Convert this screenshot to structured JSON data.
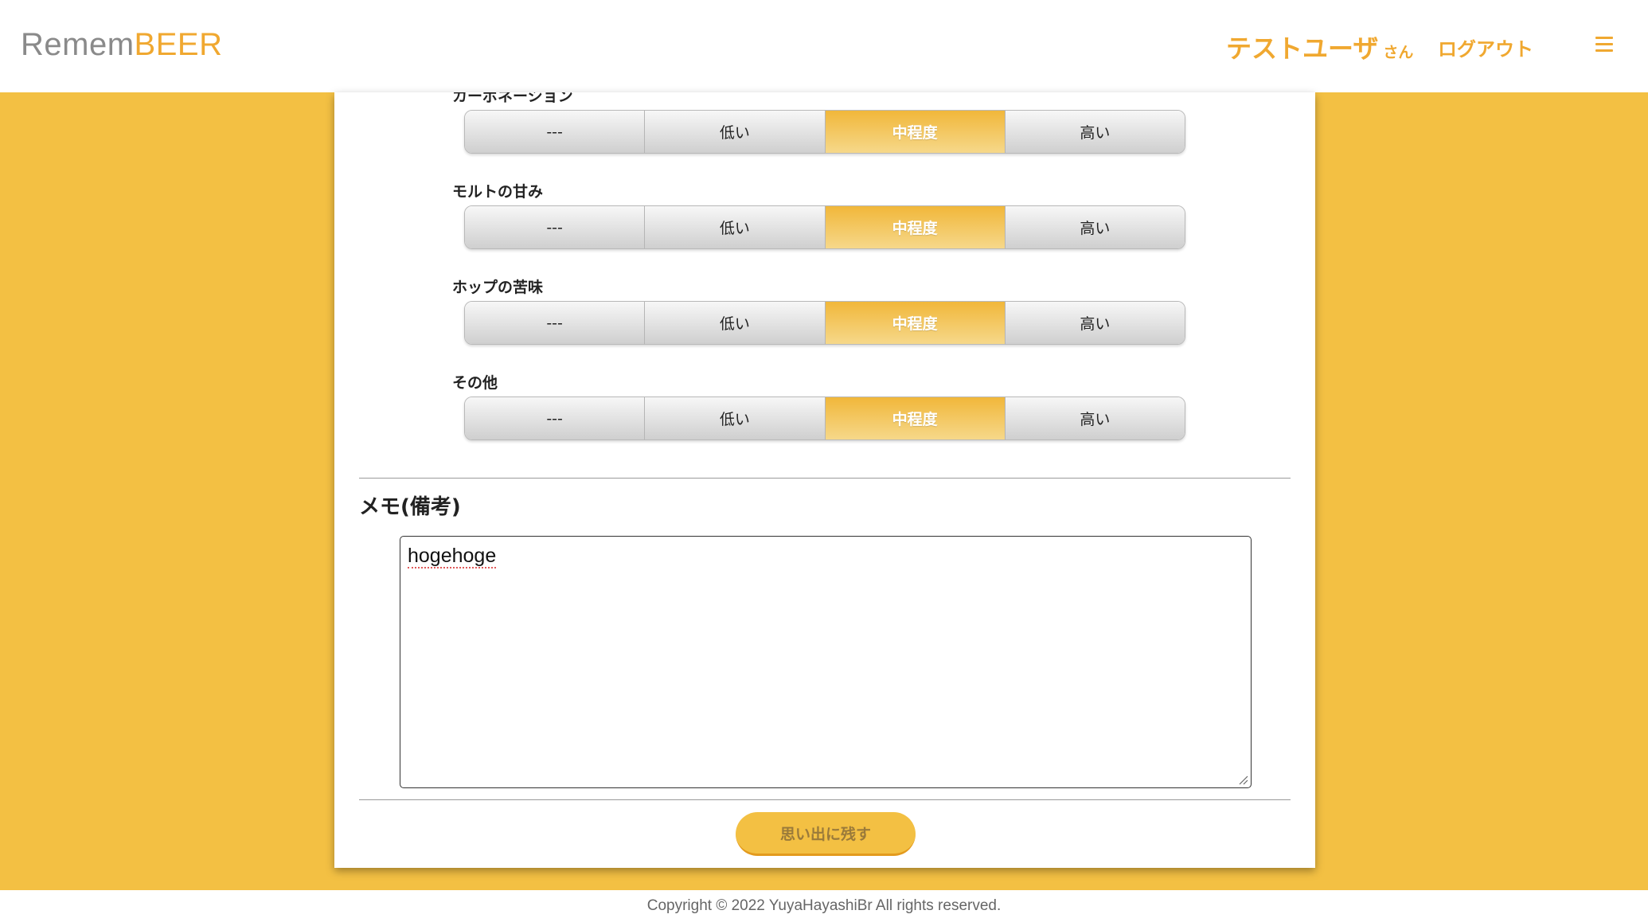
{
  "header": {
    "logo_part1": "Remem",
    "logo_part2": "BEER",
    "username": "テストユーザ",
    "username_suffix": "さん",
    "logout_label": "ログアウト",
    "menu_icon": "hamburger-menu-icon"
  },
  "ratings": [
    {
      "label": "カーボネーション",
      "options": [
        "---",
        "低い",
        "中程度",
        "高い"
      ],
      "selected": "中程度"
    },
    {
      "label": "モルトの甘み",
      "options": [
        "---",
        "低い",
        "中程度",
        "高い"
      ],
      "selected": "中程度"
    },
    {
      "label": "ホップの苦味",
      "options": [
        "---",
        "低い",
        "中程度",
        "高い"
      ],
      "selected": "中程度"
    },
    {
      "label": "その他",
      "options": [
        "---",
        "低い",
        "中程度",
        "高い"
      ],
      "selected": "中程度"
    }
  ],
  "memo": {
    "title": "メモ(備考)",
    "value": "hogehoge"
  },
  "submit_label": "思い出に残す",
  "footer": {
    "copyright": "Copyright © 2022 YuyaHayashiBr All rights reserved."
  },
  "colors": {
    "brand": "#f3c043",
    "accent": "#f0a830"
  }
}
